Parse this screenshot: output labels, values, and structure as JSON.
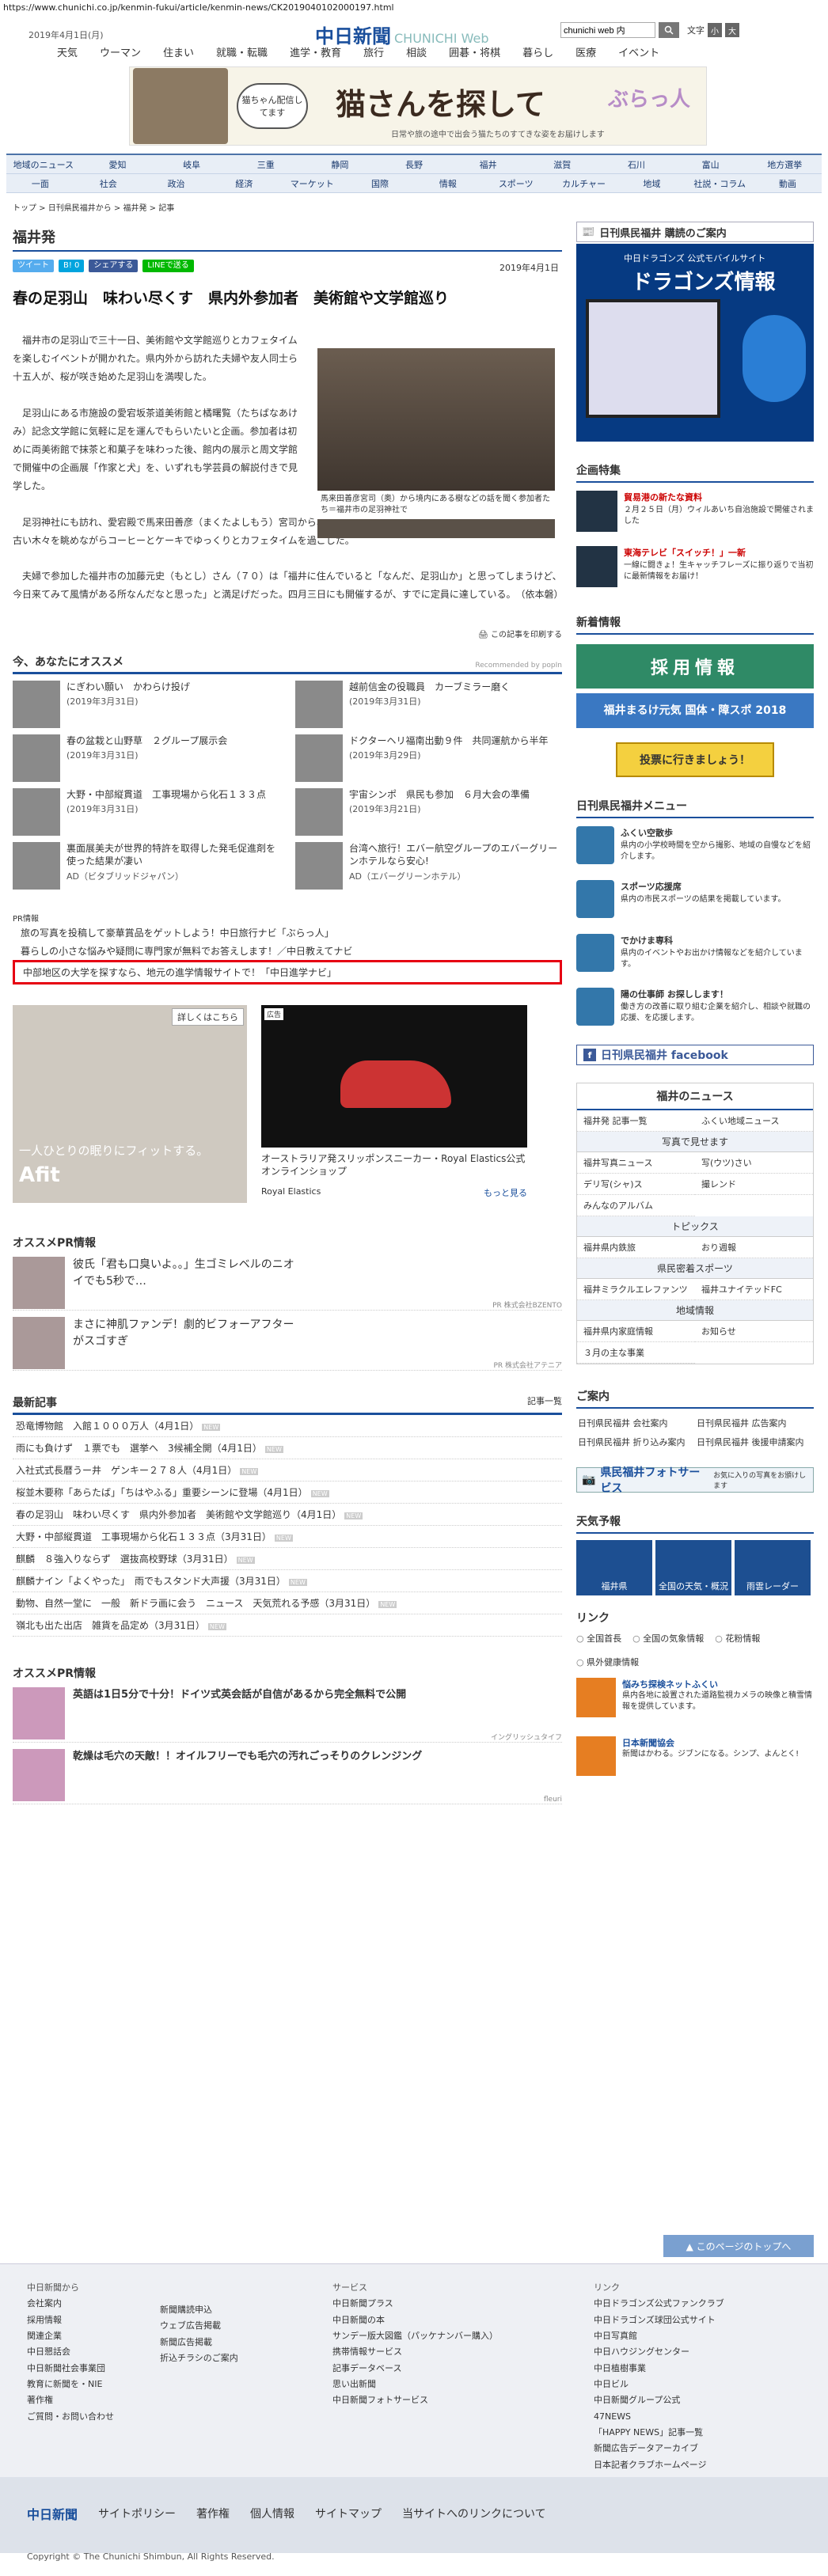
{
  "url": "https://www.chunichi.co.jp/kenmin-fukui/article/kenmin-news/CK2019040102000197.html",
  "header": {
    "date": "2019年4月1日(月)",
    "logo": "中日新聞",
    "logo_sub": "CHUNICHI Web",
    "search_value": "chunichi web 内",
    "font_label": "文字",
    "font_small": "小",
    "font_large": "大"
  },
  "gnav": [
    "天気",
    "ウーマン",
    "住まい",
    "就職・転職",
    "進学・教育",
    "旅行",
    "相談",
    "囲碁・将棋",
    "暮らし",
    "医療",
    "イベント"
  ],
  "banner": {
    "bubble": "猫ちゃん配信してます",
    "title": "猫さんを探して",
    "sub": "日常や旅の途中で出会う猫たちのすてきな姿をお届けします",
    "logo": "ぶらっ人"
  },
  "region_nav": [
    [
      "地域のニュース",
      "愛知",
      "岐阜",
      "三重",
      "静岡",
      "長野",
      "福井",
      "滋賀",
      "石川",
      "富山",
      "地方選挙"
    ],
    [
      "一面",
      "社会",
      "政治",
      "経済",
      "マーケット",
      "国際",
      "情報",
      "スポーツ",
      "カルチャー",
      "地域",
      "社説・コラム",
      "動画"
    ]
  ],
  "breadcrumb": "トップ > 日刊県民福井から > 福井発 > 記事",
  "article": {
    "section": "福井発",
    "share": [
      "ツイート",
      "B! 0",
      "シェアする",
      "LINEで送る"
    ],
    "date": "2019年4月1日",
    "headline": "春の足羽山　味わい尽くす　県内外参加者　美術館や文学館巡り",
    "caption": "馬来田善彦宮司（奥）から境内にある樹などの話を聞く参加者たち＝福井市の足羽神社で",
    "paragraphs": [
      "福井市の足羽山で三十一日、美術館や文学館巡りとカフェタイムを楽しむイベントが開かれた。県内外から訪れた夫婦や友人同士ら十五人が、桜が咲き始めた足羽山を満喫した。",
      "足羽山にある市施設の愛宕坂茶道美術館と橘曙覧（たちばなあけみ）記念文学館に気軽に足を運んでもらいたいと企画。参加者は初めに両美術館で抹茶と和菓子を味わった後、館内の展示と周文学館で開催中の企画展「作家と犬」を、いずれも学芸員の解説付きで見学した。",
      "足羽神社にも訪れ、愛宕殿で馬来田善彦（まくたよしもう）宮司から、神社の歴史や足羽山の自然について話を聞き、境内の古い木々を眺めながらコーヒーとケーキでゆっくりとカフェタイムを過ごした。",
      "夫婦で参加した福井市の加藤元史（もとし）さん（７０）は「福井に住んでいると「なんだ、足羽山か」と思ってしまうけど、今日来てみて風情がある所なんだなと思った」と満足げだった。四月三日にも開催するが、すでに定員に達している。　（依本磐）"
    ],
    "print": "この記事を印刷する"
  },
  "recommend": {
    "title": "今、あなたにオススメ",
    "by": "Recommended by popIn",
    "items": [
      {
        "t": "にぎわい願い　かわらけ投げ",
        "d": "(2019年3月31日)"
      },
      {
        "t": "越前信金の役職員　カーブミラー磨く",
        "d": "(2019年3月31日)"
      },
      {
        "t": "春の盆栽と山野草　２グループ展示会",
        "d": "(2019年3月31日)"
      },
      {
        "t": "ドクターヘリ福南出動９件　共同運航から半年",
        "d": "(2019年3月29日)"
      },
      {
        "t": "大野・中部縦貫道　工事現場から化石１３３点",
        "d": "(2019年3月31日)"
      },
      {
        "t": "宇宙シンポ　県民も参加　６月大会の準備",
        "d": "(2019年3月21日)"
      },
      {
        "t": "裏面展美夫が世界的特許を取得した発毛促進剤を使った結果が凄い",
        "d": "AD（ビタブリッドジャパン）"
      },
      {
        "t": "台湾へ旅行！エバー航空グループのエバーグリーンホテルなら安心!",
        "d": "AD（エバーグリーンホテル）"
      }
    ]
  },
  "pr": {
    "label": "PR情報",
    "items": [
      "旅の写真を投稿して豪華賞品をゲットしよう！中日旅行ナビ「ぶらっ人」",
      "暮らしの小さな悩みや疑問に専門家が無料でお答えします！／中日教えてナビ",
      "中部地区の大学を探すなら、地元の進学情報サイトで！「中日進学ナビ」"
    ]
  },
  "ads": {
    "ad1_label": "詳しくはこちら",
    "ad1_copy": "一人ひとりの眠りにフィットする。",
    "ad1_brand": "Afit",
    "ad2_label": "広告",
    "ad2_desc": "オーストラリア発スリッポンスニーカー・Royal Elastics公式オンラインショップ",
    "ad2_brand": "Royal Elastics",
    "ad2_more": "もっと見る"
  },
  "oss_pr": {
    "title": "オススメPR情報",
    "items": [
      {
        "t": "彼氏「君も口臭いよ。。」生ゴミレベルのニオイでも5秒で…",
        "src": "PR 株式会社BZENTO"
      },
      {
        "t": "まさに神肌ファンデ！劇的ビフォーアフターがスゴすぎ",
        "src": "PR 株式会社アテニア"
      }
    ]
  },
  "latest": {
    "title": "最新記事",
    "more": "記事一覧",
    "new": "NEW",
    "items": [
      "恐竜博物館　入館１０００万人（4月1日）",
      "雨にも負けず　１票でも　選挙へ　3候補全開（4月1日）",
      "入社式式長暦うー井　ゲンキー２７８人（4月1日）",
      "桜並木要称「あらたば」「ちはやふる」重要シーンに登場（4月1日）",
      "春の足羽山　味わい尽くす　県内外参加者　美術館や文学館巡り（4月1日）",
      "大野・中部縦貫道　工事現場から化石１３３点（3月31日）",
      "麒麟　８強入りならず　選抜高校野球（3月31日）",
      "麒麟ナイン「よくやった」　雨でもスタンド大声援（3月31日）",
      "動物、自然一堂に　一般　新ドラ画に会う　ニュース　天気荒れる予感（3月31日）",
      "嶺北も出た出店　雑貨を品定め（3月31日）"
    ]
  },
  "oss_pr2": {
    "title": "オススメPR情報",
    "items": [
      {
        "t": "英語は1日5分で十分！ドイツ式英会話が自信があるから完全無料で公開",
        "src": "イングリッシュタイフ"
      },
      {
        "t": "乾燥は毛穴の天敵！！オイルフリーでも毛穴の汚れごっそりのクレンジング",
        "src": "fleuri"
      }
    ]
  },
  "side": {
    "kenmin_banner": "日刊県民福井 購読のご案内",
    "dragons_sub": "中日ドラゴンズ 公式モバイルサイト",
    "dragons_title": "ドラゴンズ情報",
    "kikaku_title": "企画特集",
    "kikaku": [
      {
        "t": "貿易港の新たな資料",
        "d": "２月２５日（月）ウィルあいち自治施設で開催されました"
      },
      {
        "t": "東海テレビ「スイッチ！」一新",
        "d": "一線に闘きょ！生キャッチフレーズに振り返りで当初に最新情報をお届け！"
      }
    ],
    "shinchaku": "新着情報",
    "saiyo": "採用情報",
    "fukui_genki": "福井まるけ元気 国体・障スポ 2018",
    "tohyo": "投票に行きましょう！",
    "menu_title": "日刊県民福井メニュー",
    "menu": [
      {
        "t": "ふくい空散歩",
        "d": "県内の小学校時間を空から撮影、地域の自慢などを紹介します。"
      },
      {
        "t": "スポーツ応援席",
        "d": "県内の市民スポーツの結果を掲載しています。"
      },
      {
        "t": "でかけま専科",
        "d": "県内のイベントやお出かけ情報などを紹介しています。"
      },
      {
        "t": "陽の仕事師 お探しします！",
        "d": "働き方の改善に取り組む企業を紹介し、相談や就職の応援、を応援します。"
      }
    ],
    "facebook": "日刊県民福井 facebook",
    "fnews_title": "福井のニュース",
    "fnews_a": [
      "福井発 記事一覧",
      "ふくい地域ニュース"
    ],
    "photo_label": "写真で見せます",
    "fnews_b": [
      "福井写真ニュース",
      "写(ウツ)さい",
      "デリ写(シャ)ス",
      "撮レンド",
      "みんなのアルバム"
    ],
    "topics_label": "トピックス",
    "fnews_c": [
      "福井県内鉄旅",
      "おり週報"
    ],
    "sports_label": "県民密着スポーツ",
    "fnews_d": [
      "福井ミラクルエレファンツ",
      "福井ユナイテッドFC"
    ],
    "chiiki_label": "地域情報",
    "fnews_e": [
      "福井県内家庭情報",
      "お知らせ",
      "３月の主な事業"
    ],
    "annai_title": "ご案内",
    "annai": [
      "日刊県民福井 会社案内",
      "日刊県民福井 広告案内",
      "日刊県民福井 折り込み案内",
      "日刊県民福井 後援申請案内"
    ],
    "photo_service": "県民福井フォトサービス",
    "photo_service_sub": "お気に入りの写真をお頒けします",
    "weather_title": "天気予報",
    "weather": [
      "福井県",
      "全国の天気・概況",
      "雨雲レーダー"
    ],
    "link_title": "リンク",
    "links": [
      "全国首長",
      "全国の気象情報",
      "花粉情報",
      "県外健康情報"
    ],
    "lbox": [
      {
        "t": "悩みち探検ネットふくい",
        "d": "県内各地に設置された道路監視カメラの映像と積雪情報を提供しています。"
      },
      {
        "t": "日本新聞協会",
        "d": "新聞はかわる。ジブンになる。シンプ、よんとく!"
      }
    ]
  },
  "totop": "▲ このページのトップへ",
  "footer": {
    "col1_head": "中日新聞から",
    "col1": [
      "会社案内",
      "採用情報",
      "関連企業",
      "中日懇話会",
      "中日新聞社会事業団",
      "教育に新聞を・NIE",
      "著作権",
      "ご質問・お問い合わせ"
    ],
    "col2": [
      "新聞購読申込",
      "ウェブ広告掲載",
      "新聞広告掲載",
      "折込チラシのご案内"
    ],
    "col3_head": "サービス",
    "col3": [
      "中日新聞プラス",
      "中日新聞の本",
      "サンデー版大図鑑（パッケナンバー購入）",
      "携帯情報サービス",
      "記事データベース",
      "思い出新聞",
      "中日新聞フォトサービス"
    ],
    "col4_head": "リンク",
    "col4": [
      "中日ドラゴンズ公式ファンクラブ",
      "中日ドラゴンズ球団公式サイト",
      "中日写真館",
      "中日ハウジングセンター",
      "中日植樹事業",
      "中日ビル",
      "中日新聞グループ公式",
      "47NEWS",
      "「HAPPY NEWS」記事一覧",
      "新聞広告データアーカイブ",
      "日本記者クラブホームページ"
    ],
    "nav": [
      "中日新聞",
      "サイトポリシー",
      "著作権",
      "個人情報",
      "サイトマップ",
      "当サイトへのリンクについて"
    ],
    "copy": "Copyright © The Chunichi Shimbun, All Rights Reserved."
  }
}
